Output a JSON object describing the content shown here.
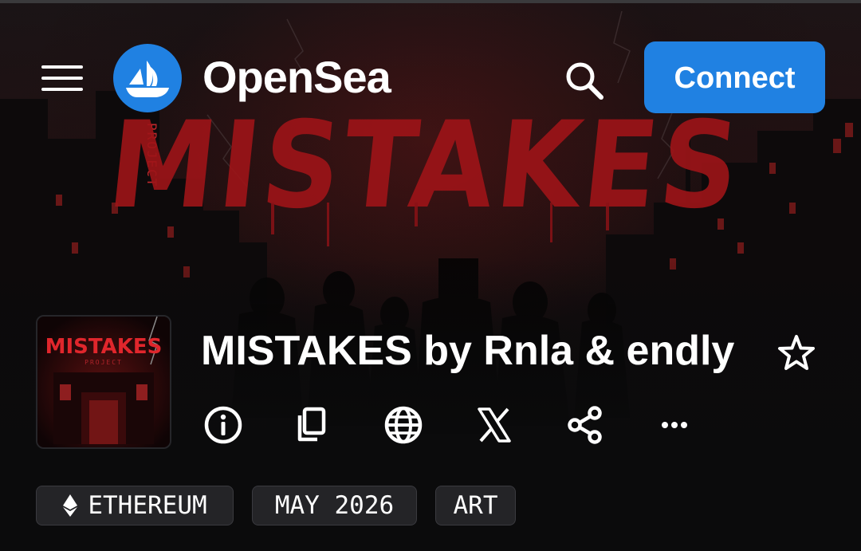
{
  "header": {
    "brand": "OpenSea",
    "connect_label": "Connect"
  },
  "banner": {
    "headline": "MISTAKES",
    "sign_text": "PROJECT"
  },
  "avatar": {
    "title": "MISTAKES",
    "subtitle": "PROJECT"
  },
  "collection": {
    "title": "MISTAKES by Rnla & endly"
  },
  "actions": [
    {
      "icon": "info-icon"
    },
    {
      "icon": "copy-icon"
    },
    {
      "icon": "globe-icon"
    },
    {
      "icon": "x-logo-icon"
    },
    {
      "icon": "share-icon"
    },
    {
      "icon": "more-icon"
    }
  ],
  "chips": [
    {
      "label": "ETHEREUM",
      "icon": "ethereum-icon"
    },
    {
      "label": "MAY 2026"
    },
    {
      "label": "ART"
    }
  ],
  "colors": {
    "accent": "#2081e2",
    "blood_red": "#b0171c",
    "chip_bg": "#242427"
  }
}
